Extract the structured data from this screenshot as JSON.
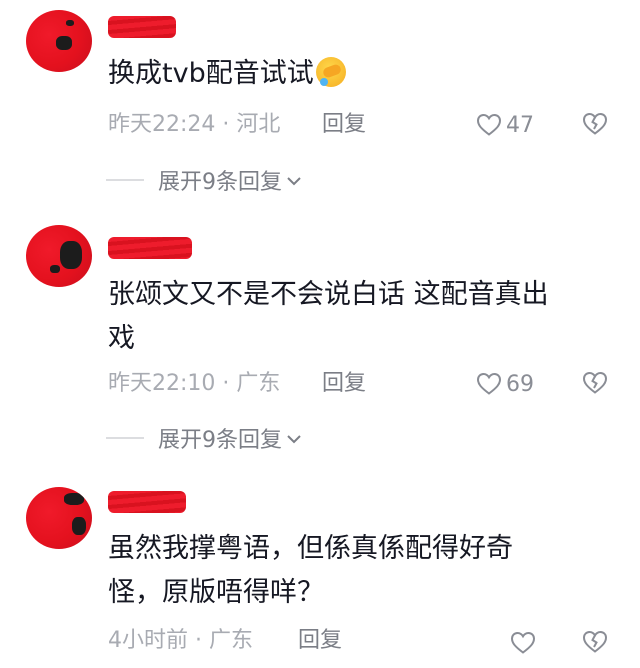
{
  "comments": [
    {
      "text": "换成tvb配音试试",
      "emoji": "face-with-hand-over-mouth-laughing-emoji",
      "time": "昨天22:24",
      "separator": "·",
      "location": "河北",
      "reply_label": "回复",
      "likes": "47",
      "expand_label": "展开9条回复"
    },
    {
      "text_line1": "张颂文又不是不会说白话 这配音真出",
      "text_line2": "戏",
      "time": "昨天22:10",
      "separator": "·",
      "location": "广东",
      "reply_label": "回复",
      "likes": "69",
      "expand_label": "展开9条回复"
    },
    {
      "text_line1": "虽然我撑粤语，但係真係配得好奇",
      "text_line2": "怪，原版唔得咩？",
      "time": "4小时前",
      "separator": "·",
      "location": "广东",
      "reply_label": "回复",
      "likes": ""
    }
  ],
  "colors": {
    "text": "#161823",
    "meta": "#a8abb2",
    "action": "#7b7e86",
    "redaction": "#e4111e"
  }
}
